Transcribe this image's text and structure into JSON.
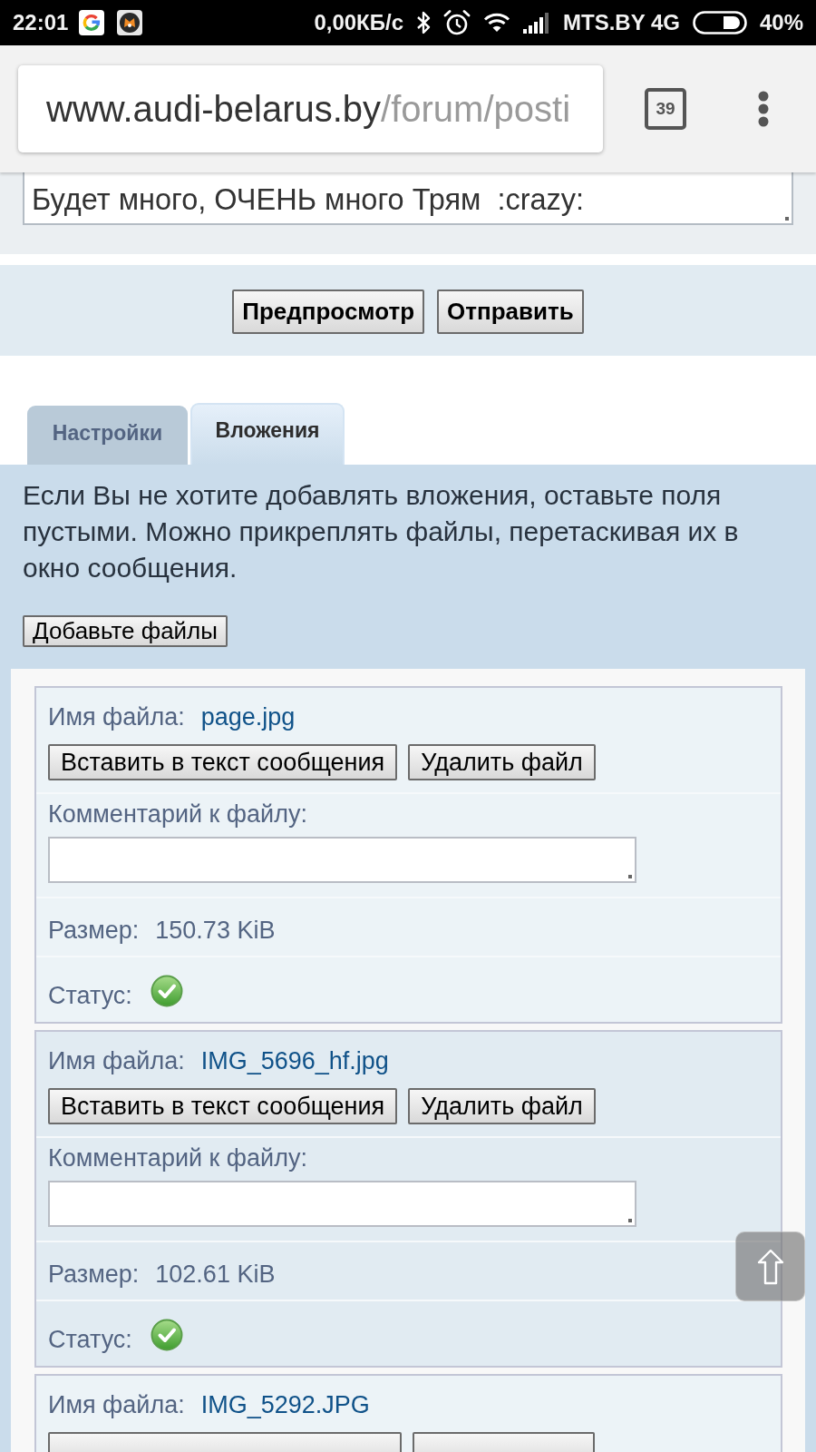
{
  "status_bar": {
    "time": "22:01",
    "network_speed": "0,00КБ/с",
    "carrier": "MTS.BY 4G",
    "battery": "40%"
  },
  "browser": {
    "url_host": "www.audi-belarus.by",
    "url_path": "/forum/posti",
    "tab_count": "39"
  },
  "message_box": {
    "text": "Будет много, ОЧЕНЬ много Трям  :crazy:"
  },
  "submit_buttons": [
    "Предпросмотр",
    "Отправить"
  ],
  "tabs": [
    {
      "label": "Настройки",
      "selected": false
    },
    {
      "label": "Вложения",
      "selected": true
    }
  ],
  "attachments": {
    "hint": "Если Вы не хотите добавлять вложения, оставьте поля пустыми. Можно прикреплять файлы, перетаскивая их в окно сообщения.",
    "add_button": "Добавьте файлы",
    "files": [
      {
        "name_label": "Имя файла:",
        "file_name": "page.jpg",
        "buttons": [
          {
            "kind": "labeled",
            "label": "Вставить в текст сообщения"
          },
          {
            "kind": "labeled",
            "label": "Удалить файл"
          }
        ],
        "comment_label": "Комментарий к файлу:",
        "size_label": "Размер:",
        "size": "150.73 KiB",
        "status_label": "Статус:",
        "uploaded": true
      },
      {
        "name_label": "Имя файла:",
        "file_name": "IMG_5696_hf.jpg",
        "buttons": [
          {
            "kind": "labeled",
            "label": "Вставить в текст сообщения"
          },
          {
            "kind": "labeled",
            "label": "Удалить файл"
          }
        ],
        "comment_label": "Комментарий к файлу:",
        "size_label": "Размер:",
        "size": "102.61 KiB",
        "status_label": "Статус:",
        "uploaded": true
      },
      {
        "name_label": "Имя файла:",
        "file_name": "IMG_5292.JPG",
        "buttons": [
          {
            "kind": "cut"
          },
          {
            "kind": "cut"
          }
        ]
      }
    ]
  }
}
